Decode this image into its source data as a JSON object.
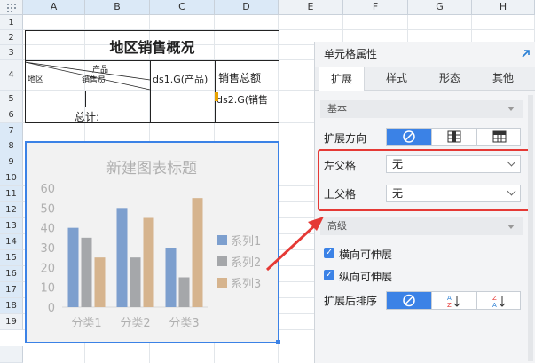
{
  "columns": [
    "A",
    "B",
    "C",
    "D",
    "E",
    "F",
    "G",
    "H"
  ],
  "rows": [
    "1",
    "2",
    "3",
    "4",
    "5",
    "6",
    "7",
    "8",
    "9",
    "10",
    "11",
    "12",
    "13",
    "14",
    "15",
    "16",
    "17",
    "18",
    "19"
  ],
  "report": {
    "title": "地区销售概况",
    "header_product": "产品",
    "header_salesperson": "销售员",
    "header_region": "地区",
    "cell_c3": "ds1.G(产品)",
    "cell_d3": "销售总额",
    "cell_d4": "ds2.G(销售",
    "total_label": "总计:"
  },
  "chart_data": {
    "type": "bar",
    "title": "新建图表标题",
    "categories": [
      "分类1",
      "分类2",
      "分类3"
    ],
    "ylim": [
      0,
      60
    ],
    "yticks": [
      "0",
      "10",
      "20",
      "30",
      "40",
      "50",
      "60"
    ],
    "legend_position": "right",
    "series": [
      {
        "name": "系列1",
        "color": "#7d9fce",
        "values": [
          40,
          50,
          30
        ]
      },
      {
        "name": "系列2",
        "color": "#a5a7aa",
        "values": [
          35,
          25,
          15
        ]
      },
      {
        "name": "系列3",
        "color": "#d6b48e",
        "values": [
          25,
          45,
          55
        ]
      }
    ]
  },
  "panel": {
    "title": "单元格属性",
    "tabs": [
      "扩展",
      "样式",
      "形态",
      "其他"
    ],
    "section_basic": "基本",
    "expand_direction_label": "扩展方向",
    "left_parent_label": "左父格",
    "left_parent_value": "无",
    "top_parent_label": "上父格",
    "top_parent_value": "无",
    "section_advanced": "高级",
    "horizontal_extend_label": "横向可伸展",
    "vertical_extend_label": "纵向可伸展",
    "sort_label": "扩展后排序"
  },
  "colors": {
    "accent": "#3b82e6",
    "highlight": "#e53935"
  }
}
